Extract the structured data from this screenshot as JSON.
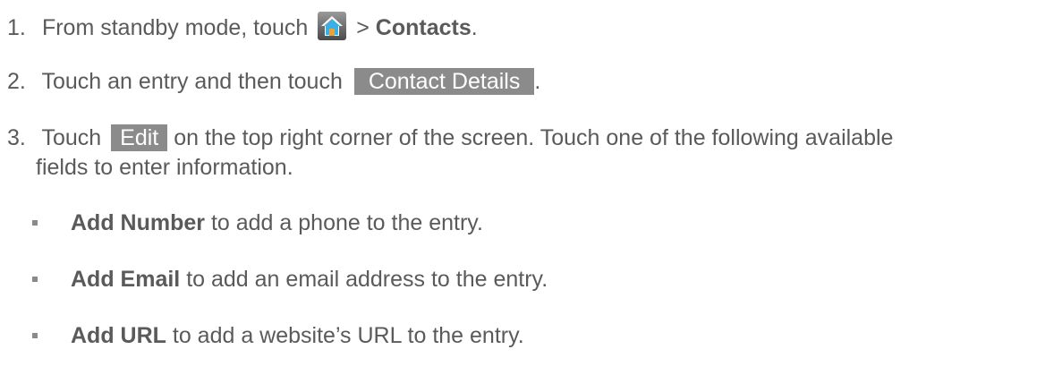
{
  "steps": [
    {
      "number": "1.",
      "prefix": "From standby mode, touch",
      "separator": ">",
      "bold": "Contacts",
      "suffix": "."
    },
    {
      "number": "2.",
      "prefix": "Touch an entry and then touch",
      "button": "Contact Details",
      "suffix": "."
    },
    {
      "number": "3.",
      "prefix": "Touch",
      "button": "Edit",
      "line1_rest": "on the top right corner of the screen. Touch one of the following available",
      "line2": "fields to enter information."
    }
  ],
  "bullets": [
    {
      "bold": "Add Number",
      "text": "to add a phone to the entry."
    },
    {
      "bold": "Add Email",
      "text": "to add an email address to the entry."
    },
    {
      "bold": "Add URL",
      "text": "to add a website’s URL to the entry."
    }
  ],
  "icons": {
    "home": "home-icon"
  }
}
